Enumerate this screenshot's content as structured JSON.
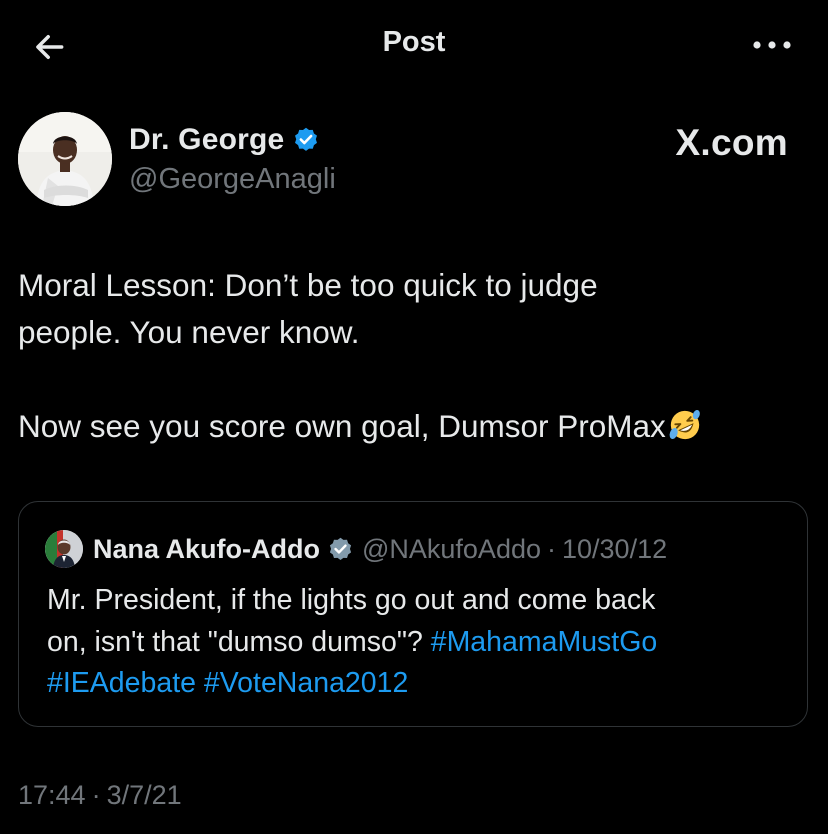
{
  "header": {
    "title": "Post",
    "back_icon": "arrow-left-icon",
    "more_icon": "more-horizontal-icon"
  },
  "author": {
    "display_name": "Dr. George",
    "handle": "@GeorgeAnagli",
    "verified": true,
    "watermark": "X.com"
  },
  "post": {
    "line1": "Moral Lesson: Don’t be too quick to judge",
    "line2": "people. You never know.",
    "line3": "Now see you score own goal, Dumsor ProMax",
    "emoji": "rolling-on-floor-laughing-emoji"
  },
  "quoted": {
    "display_name": "Nana Akufo-Addo",
    "handle": "@NAkufoAddo",
    "separator": "·",
    "date": "10/30/12",
    "verified": true,
    "text_line1": "Mr. President, if the lights go out and come back",
    "text_line2_plain": "on, isn't that \"dumso dumso\"?",
    "hashtags": [
      "#MahamaMustGo",
      "#IEAdebate",
      "#VoteNana2012"
    ]
  },
  "meta": {
    "time": "17:44",
    "separator": "·",
    "date": "3/7/21"
  },
  "colors": {
    "background": "#000000",
    "text": "#e7e9ea",
    "muted": "#71767b",
    "accent": "#1d9bf0",
    "border": "#2f3336",
    "verified_blue": "#1d9bf0",
    "verified_gray": "#829aab"
  }
}
